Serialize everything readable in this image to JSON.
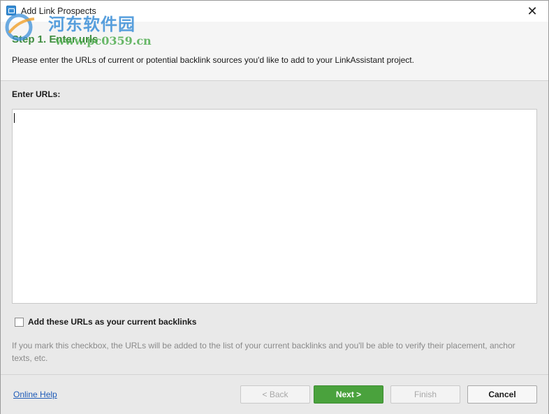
{
  "window": {
    "title": "Add Link Prospects",
    "close_label": "✕"
  },
  "header": {
    "step_title": "Step 1. Enter urls",
    "description": "Please enter the URLs of current or potential backlink sources you'd like to add to your LinkAssistant project."
  },
  "watermark": {
    "site_name": "河东软件园",
    "url": "www.pc0359.cn"
  },
  "main": {
    "urls_label": "Enter URLs:",
    "urls_value": "",
    "checkbox": {
      "label": "Add these URLs as your current backlinks",
      "checked": false
    },
    "hint": "If you mark this checkbox, the URLs will be added to the list of your current backlinks and you'll be able to verify their placement, anchor texts, etc."
  },
  "footer": {
    "help_link": "Online Help",
    "back_label": "< Back",
    "next_label": "Next >",
    "finish_label": "Finish",
    "cancel_label": "Cancel"
  },
  "colors": {
    "primary_button": "#4aa23d",
    "link": "#1e5bb8",
    "disabled_text": "#a7a7a7"
  },
  "icons": {
    "app": "link-assistant-app-icon",
    "close": "close-icon",
    "watermark_logo": "watermark-logo-icon"
  }
}
